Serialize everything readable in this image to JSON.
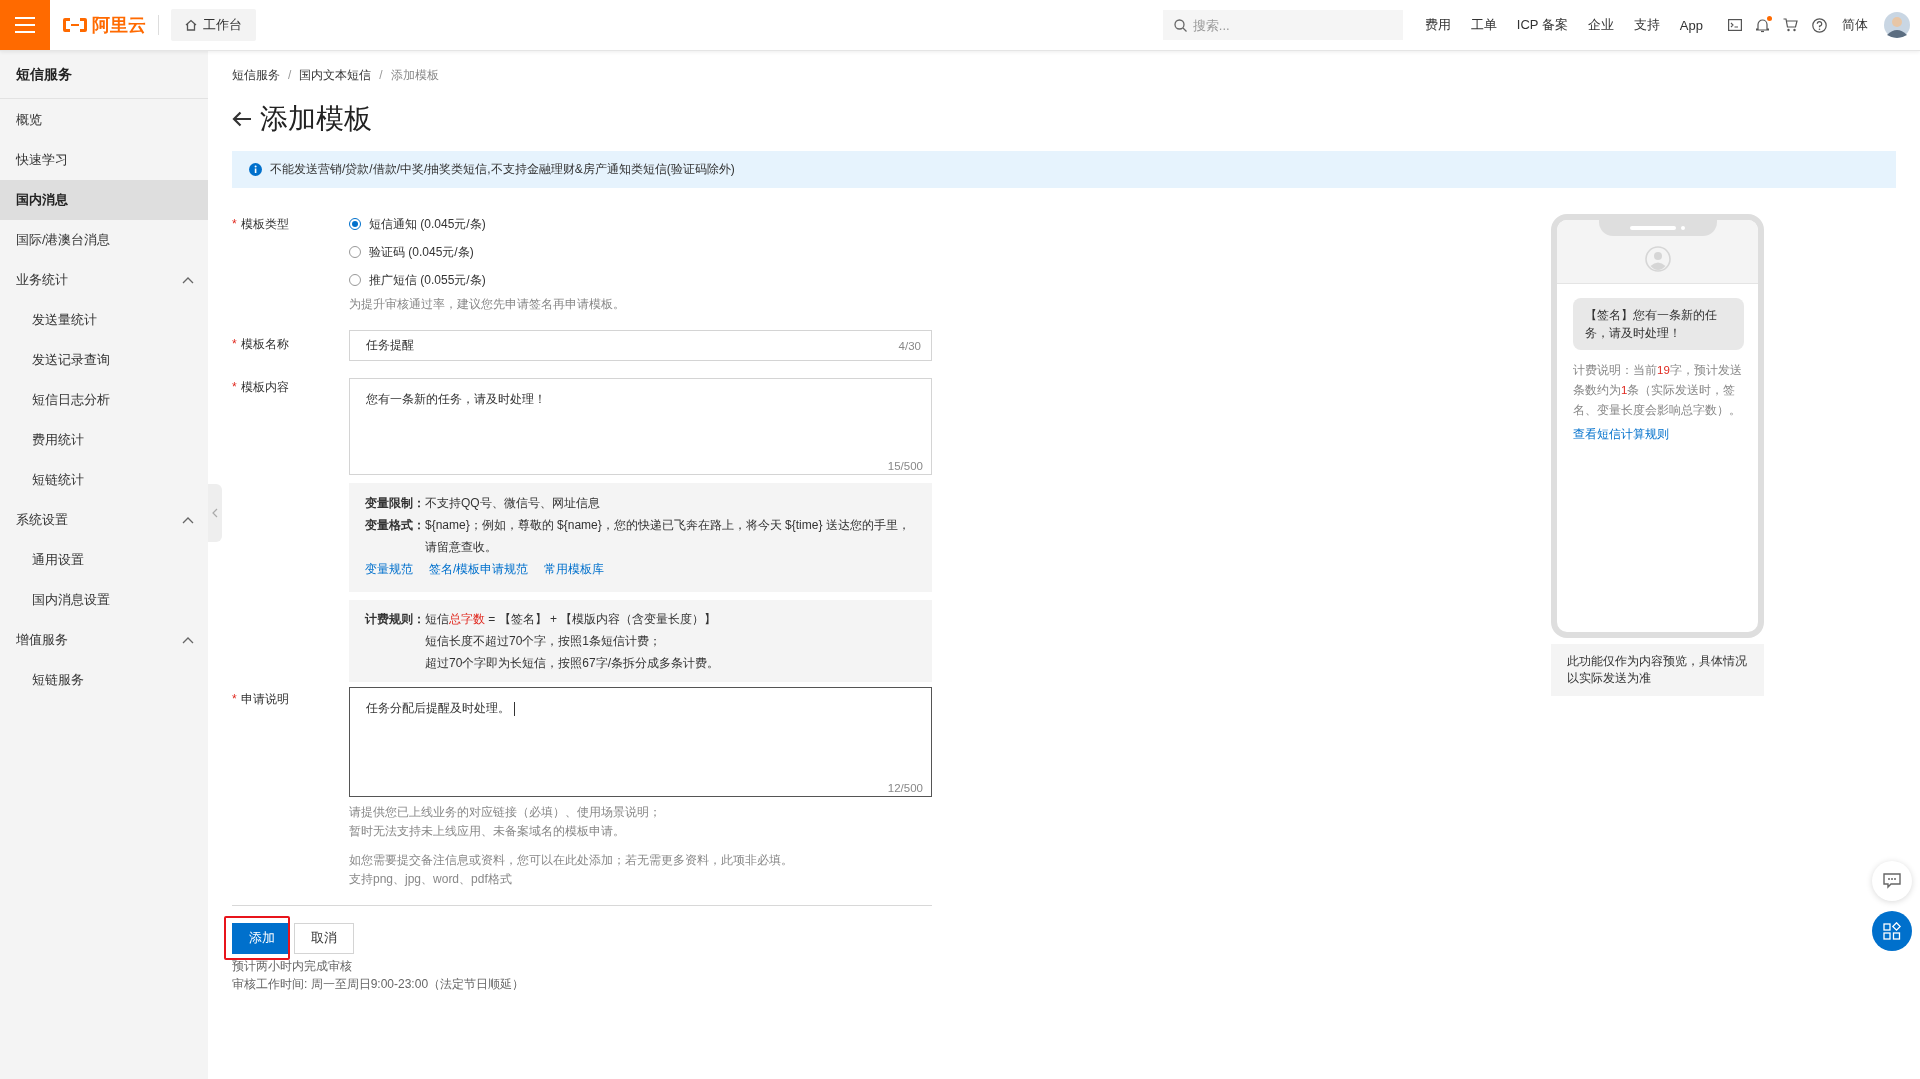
{
  "topbar": {
    "logo": "阿里云",
    "workbench": "工作台",
    "search": {
      "placeholder": "搜索..."
    },
    "nav_links": [
      "费用",
      "工单",
      "ICP 备案",
      "企业",
      "支持",
      "App"
    ],
    "notifications": {
      "unread": true
    },
    "language": "简体"
  },
  "sidebar": {
    "title": "短信服务",
    "items": [
      {
        "label": "概览",
        "selected": false
      },
      {
        "label": "快速学习",
        "selected": false
      },
      {
        "label": "国内消息",
        "selected": true
      },
      {
        "label": "国际/港澳台消息",
        "selected": false
      },
      {
        "label": "业务统计",
        "selected": false,
        "expanded": true,
        "children": [
          {
            "label": "发送量统计",
            "selected": false
          },
          {
            "label": "发送记录查询",
            "selected": false
          },
          {
            "label": "短信日志分析",
            "selected": false
          },
          {
            "label": "费用统计",
            "selected": false
          },
          {
            "label": "短链统计",
            "selected": false
          }
        ]
      },
      {
        "label": "系统设置",
        "selected": false,
        "expanded": true,
        "children": [
          {
            "label": "通用设置",
            "selected": false
          },
          {
            "label": "国内消息设置",
            "selected": false
          }
        ]
      },
      {
        "label": "增值服务",
        "selected": false,
        "expanded": true,
        "children": [
          {
            "label": "短链服务",
            "selected": false
          }
        ]
      }
    ]
  },
  "breadcrumb": [
    {
      "label": "短信服务",
      "separator": "/"
    },
    {
      "label": "国内文本短信",
      "separator": "/"
    },
    {
      "label": "添加模板"
    }
  ],
  "page_title": "添加模板",
  "alert": "不能发送营销/贷款/借款/中奖/抽奖类短信,不支持金融理财&房产通知类短信(验证码除外)",
  "form": {
    "template_type": {
      "label": "模板类型",
      "required_mark": "*",
      "options": [
        {
          "label": "短信通知 (0.045元/条)",
          "selected": true
        },
        {
          "label": "验证码 (0.045元/条)",
          "selected": false
        },
        {
          "label": "推广短信 (0.055元/条)",
          "selected": false
        }
      ],
      "hint": "为提升审核通过率，建议您先申请签名再申请模板。"
    },
    "template_name": {
      "label": "模板名称",
      "required_mark": "*",
      "value": "任务提醒",
      "counter": "4/30"
    },
    "template_content": {
      "label": "模板内容",
      "required_mark": "*",
      "value": "您有一条新的任务，请及时处理！",
      "counter": "15/500"
    },
    "variable_tips": {
      "rows": [
        {
          "label": "变量限制：",
          "value": "不支持QQ号、微信号、网址信息"
        },
        {
          "label": "变量格式：",
          "value": "${name}；例如，尊敬的 ${name}，您的快递已飞奔在路上，将今天 ${time} 送达您的手里，请留意查收。"
        }
      ],
      "links": [
        "变量规范",
        "签名/模板申请规范",
        "常用模板库"
      ]
    },
    "billing_rules": {
      "label": "计费规则：",
      "lines": [
        {
          "parts": [
            {
              "text": "短信",
              "highlight": false
            },
            {
              "text": "总字数",
              "highlight": true
            },
            {
              "text": " = 【签名】 + 【模版内容（含变量长度）】",
              "highlight": false
            }
          ]
        },
        {
          "parts": [
            {
              "text": "短信长度不超过70个字，按照1条短信计费；",
              "highlight": false
            }
          ]
        },
        {
          "parts": [
            {
              "text": "超过70个字即为长短信，按照67字/条拆分成多条计费。",
              "highlight": false
            }
          ]
        }
      ]
    },
    "application": {
      "label": "申请说明",
      "required_mark": "*",
      "value": "任务分配后提醒及时处理。",
      "focused": true,
      "counter": "12/500",
      "hints": [
        [
          "请提供您已上线业务的对应链接（必填）、使用场景说明；",
          "暂时无法支持未上线应用、未备案域名的模板申请。"
        ],
        [
          "如您需要提交备注信息或资料，您可以在此处添加；若无需更多资料，此项非必填。",
          "支持png、jpg、word、pdf格式"
        ]
      ]
    }
  },
  "actions": {
    "buttons": [
      {
        "label": "添加",
        "kind": "primary"
      },
      {
        "label": "取消",
        "kind": "default"
      }
    ],
    "highlighted": true,
    "notes": [
      "预计两小时内完成审核",
      "审核工作时间: 周一至周日9:00-23:00（法定节日顺延）"
    ]
  },
  "preview": {
    "message": "【签名】您有一条新的任务，请及时处理！",
    "billing_note": [
      {
        "text": "计费说明：当前",
        "highlight": false
      },
      {
        "text": "19",
        "highlight": true
      },
      {
        "text": "字，预计发送条数约为",
        "highlight": false
      },
      {
        "text": "1",
        "highlight": true
      },
      {
        "text": "条（实际发送时，签名、变量长度会影响总字数）。",
        "highlight": false
      }
    ],
    "link": "查看短信计算规则",
    "disclaimer": "此功能仅作为内容预览，具体情况以实际发送为准"
  }
}
